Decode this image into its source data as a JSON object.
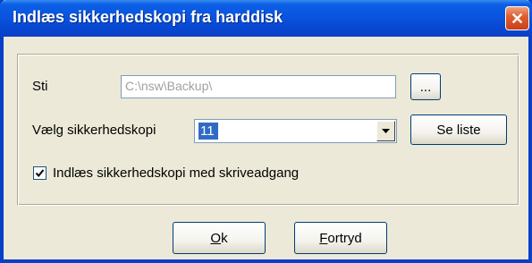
{
  "window": {
    "title": "Indlæs sikkerhedskopi fra harddisk",
    "close_glyph": "✕"
  },
  "form": {
    "path_label": "Sti",
    "path_value": "C:\\nsw\\Backup\\",
    "browse_label": "...",
    "backup_label": "Vælg sikkerhedskopi",
    "backup_value": "11",
    "show_list_label": "Se liste",
    "write_access_label": "Indlæs sikkerhedskopi med skriveadgang",
    "write_access_checked": true
  },
  "buttons": {
    "ok_mnemonic": "O",
    "ok_rest": "k",
    "cancel_mnemonic": "F",
    "cancel_rest": "ortryd"
  },
  "icons": {
    "close": "close-icon",
    "dropdown": "chevron-down-icon",
    "check": "checkmark-icon"
  },
  "colors": {
    "titlebar": "#0a54df",
    "dialog_bg": "#ece9d8",
    "close_button": "#e0602f",
    "selection": "#316ac5"
  }
}
